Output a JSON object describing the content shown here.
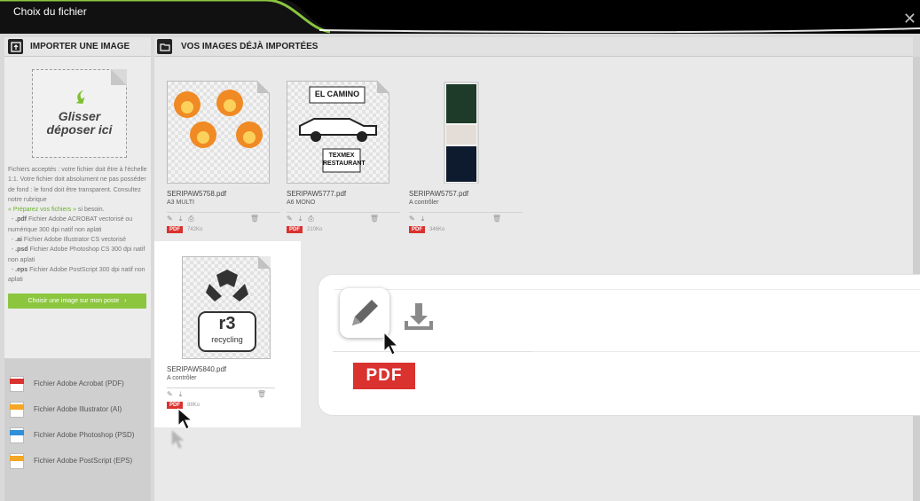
{
  "window": {
    "title": "Choix du fichier",
    "close_glyph": "✕"
  },
  "left_panel": {
    "header": "IMPORTER UNE IMAGE",
    "header_icon": "image-upload-icon",
    "dropzone": {
      "line1": "Glisser",
      "line2": "déposer ici"
    },
    "info": {
      "intro": "Fichiers acceptés : votre fichier doit être à l'échelle 1:1. Votre fichier doit absolument ne pas posséder de fond : le fond doit être transparent. Consultez notre rubrique",
      "link": "« Préparez vos fichiers »",
      "link_suffix": "si besoin.",
      "items": [
        {
          "ext": ".pdf",
          "desc": "Fichier Adobe ACROBAT vectorisé ou numérique 300 dpi natif non aplati"
        },
        {
          "ext": ".ai",
          "desc": "Fichier Adobe Illustrator CS vectorisé"
        },
        {
          "ext": ".psd",
          "desc": "Fichier Adobe Photoshop CS 300 dpi natif non aplati"
        },
        {
          "ext": ".eps",
          "desc": "Fichier Adobe PostScript 300 dpi natif non aplati"
        }
      ]
    },
    "choose_button": "Choisir une image sur mon poste",
    "choose_arrow": "›",
    "legend": [
      {
        "label": "Fichier Adobe Acrobat (PDF)",
        "color": "#d9322f",
        "tag": "PDF"
      },
      {
        "label": "Fichier Adobe Illustrator (AI)",
        "color": "#f5a623",
        "tag": "AI"
      },
      {
        "label": "Fichier Adobe Photoshop (PSD)",
        "color": "#2f8fd9",
        "tag": "PSD"
      },
      {
        "label": "Fichier Adobe PostScript (EPS)",
        "color": "#f5a623",
        "tag": "EPS"
      }
    ]
  },
  "right_panel": {
    "header": "VOS IMAGES DÉJÀ IMPORTÉES",
    "header_icon": "folder-open-icon",
    "files": [
      {
        "name": "SERIPAW5758.pdf",
        "sub": "A3 MULTI",
        "badge": "PDF",
        "size": "742Ko",
        "thumb": "orange-logos"
      },
      {
        "name": "SERIPAW5777.pdf",
        "sub": "A6 MONO",
        "badge": "PDF",
        "size": "210Ko",
        "thumb": "el-camino"
      },
      {
        "name": "SERIPAW5757.pdf",
        "sub": "A contrôler",
        "badge": "PDF",
        "size": "346Ko",
        "thumb": "vertical-strip"
      },
      {
        "name": "SERIPAW5840.pdf",
        "sub": "A contrôler",
        "badge": "PDF",
        "size": "88Ko",
        "thumb": "r3-recycling"
      }
    ],
    "thumb_text": {
      "el_camino_top": "EL CAMINO",
      "el_camino_bottom1": "TEXMEX",
      "el_camino_bottom2": "RESTAURANT",
      "r3": "r3",
      "recycling": "recycling"
    },
    "icons": {
      "edit": "✎",
      "download": "⤓",
      "print": "⎙",
      "delete": "🗑"
    }
  },
  "zoom": {
    "badge": "PDF"
  }
}
